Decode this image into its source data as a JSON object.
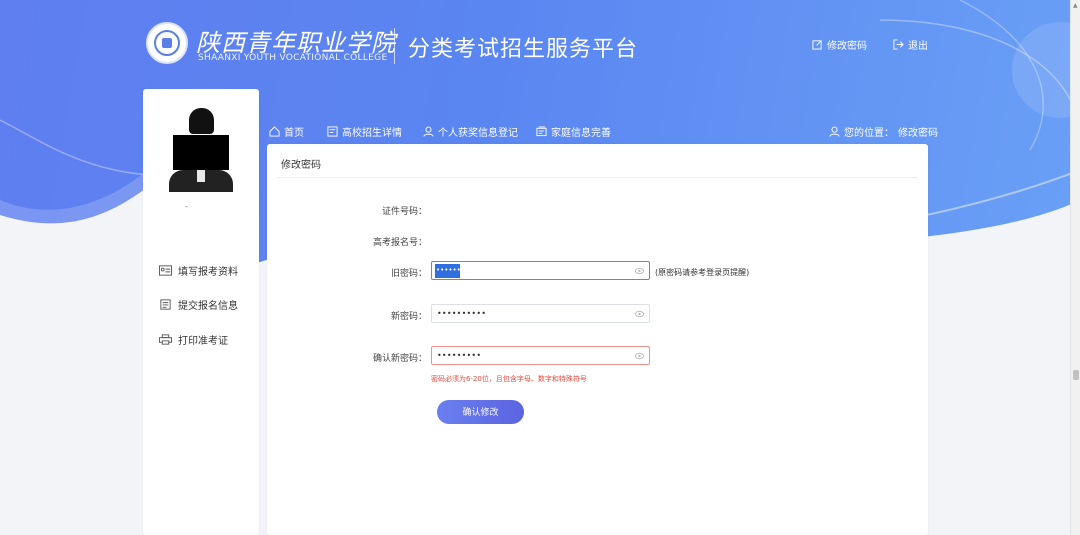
{
  "brand": {
    "school_cn": "陕西青年职业学院",
    "school_en": "SHAANXI YOUTH VOCATIONAL COLLEGE",
    "platform_title": "分类考试招生服务平台"
  },
  "top_links": {
    "change_password": "修改密码",
    "logout": "退出"
  },
  "sidebar": {
    "user_name": "-",
    "menu": [
      {
        "label": "填写报考资料",
        "icon": "id-card-icon"
      },
      {
        "label": "提交报名信息",
        "icon": "document-icon"
      },
      {
        "label": "打印准考证",
        "icon": "printer-icon"
      }
    ]
  },
  "nav": [
    {
      "label": "首页",
      "icon": "home-icon"
    },
    {
      "label": "高校招生详情",
      "icon": "book-icon"
    },
    {
      "label": "个人获奖信息登记",
      "icon": "user-icon"
    },
    {
      "label": "家庭信息完善",
      "icon": "folder-icon"
    }
  ],
  "breadcrumb": {
    "label": "您的位置：",
    "current": "修改密码"
  },
  "form": {
    "title": "修改密码",
    "id_label": "证件号码：",
    "exam_no_label": "高考报名号：",
    "old_pwd_label": "旧密码：",
    "old_pwd_value": "•••••••••",
    "old_pwd_hint": "(原密码请参考登录页提醒)",
    "new_pwd_label": "新密码：",
    "new_pwd_value": "••••••••••",
    "confirm_pwd_label": "确认新密码：",
    "confirm_pwd_value": "•••••••••",
    "error_msg": "密码必须为6-20位，且包含字母、数字和特殊符号",
    "submit_label": "确认修改"
  },
  "colors": {
    "accent": "#5b6ce6",
    "hero_blue": "#5f82ef",
    "input_active": "#4a8ff0",
    "error_red": "#e5483d"
  }
}
